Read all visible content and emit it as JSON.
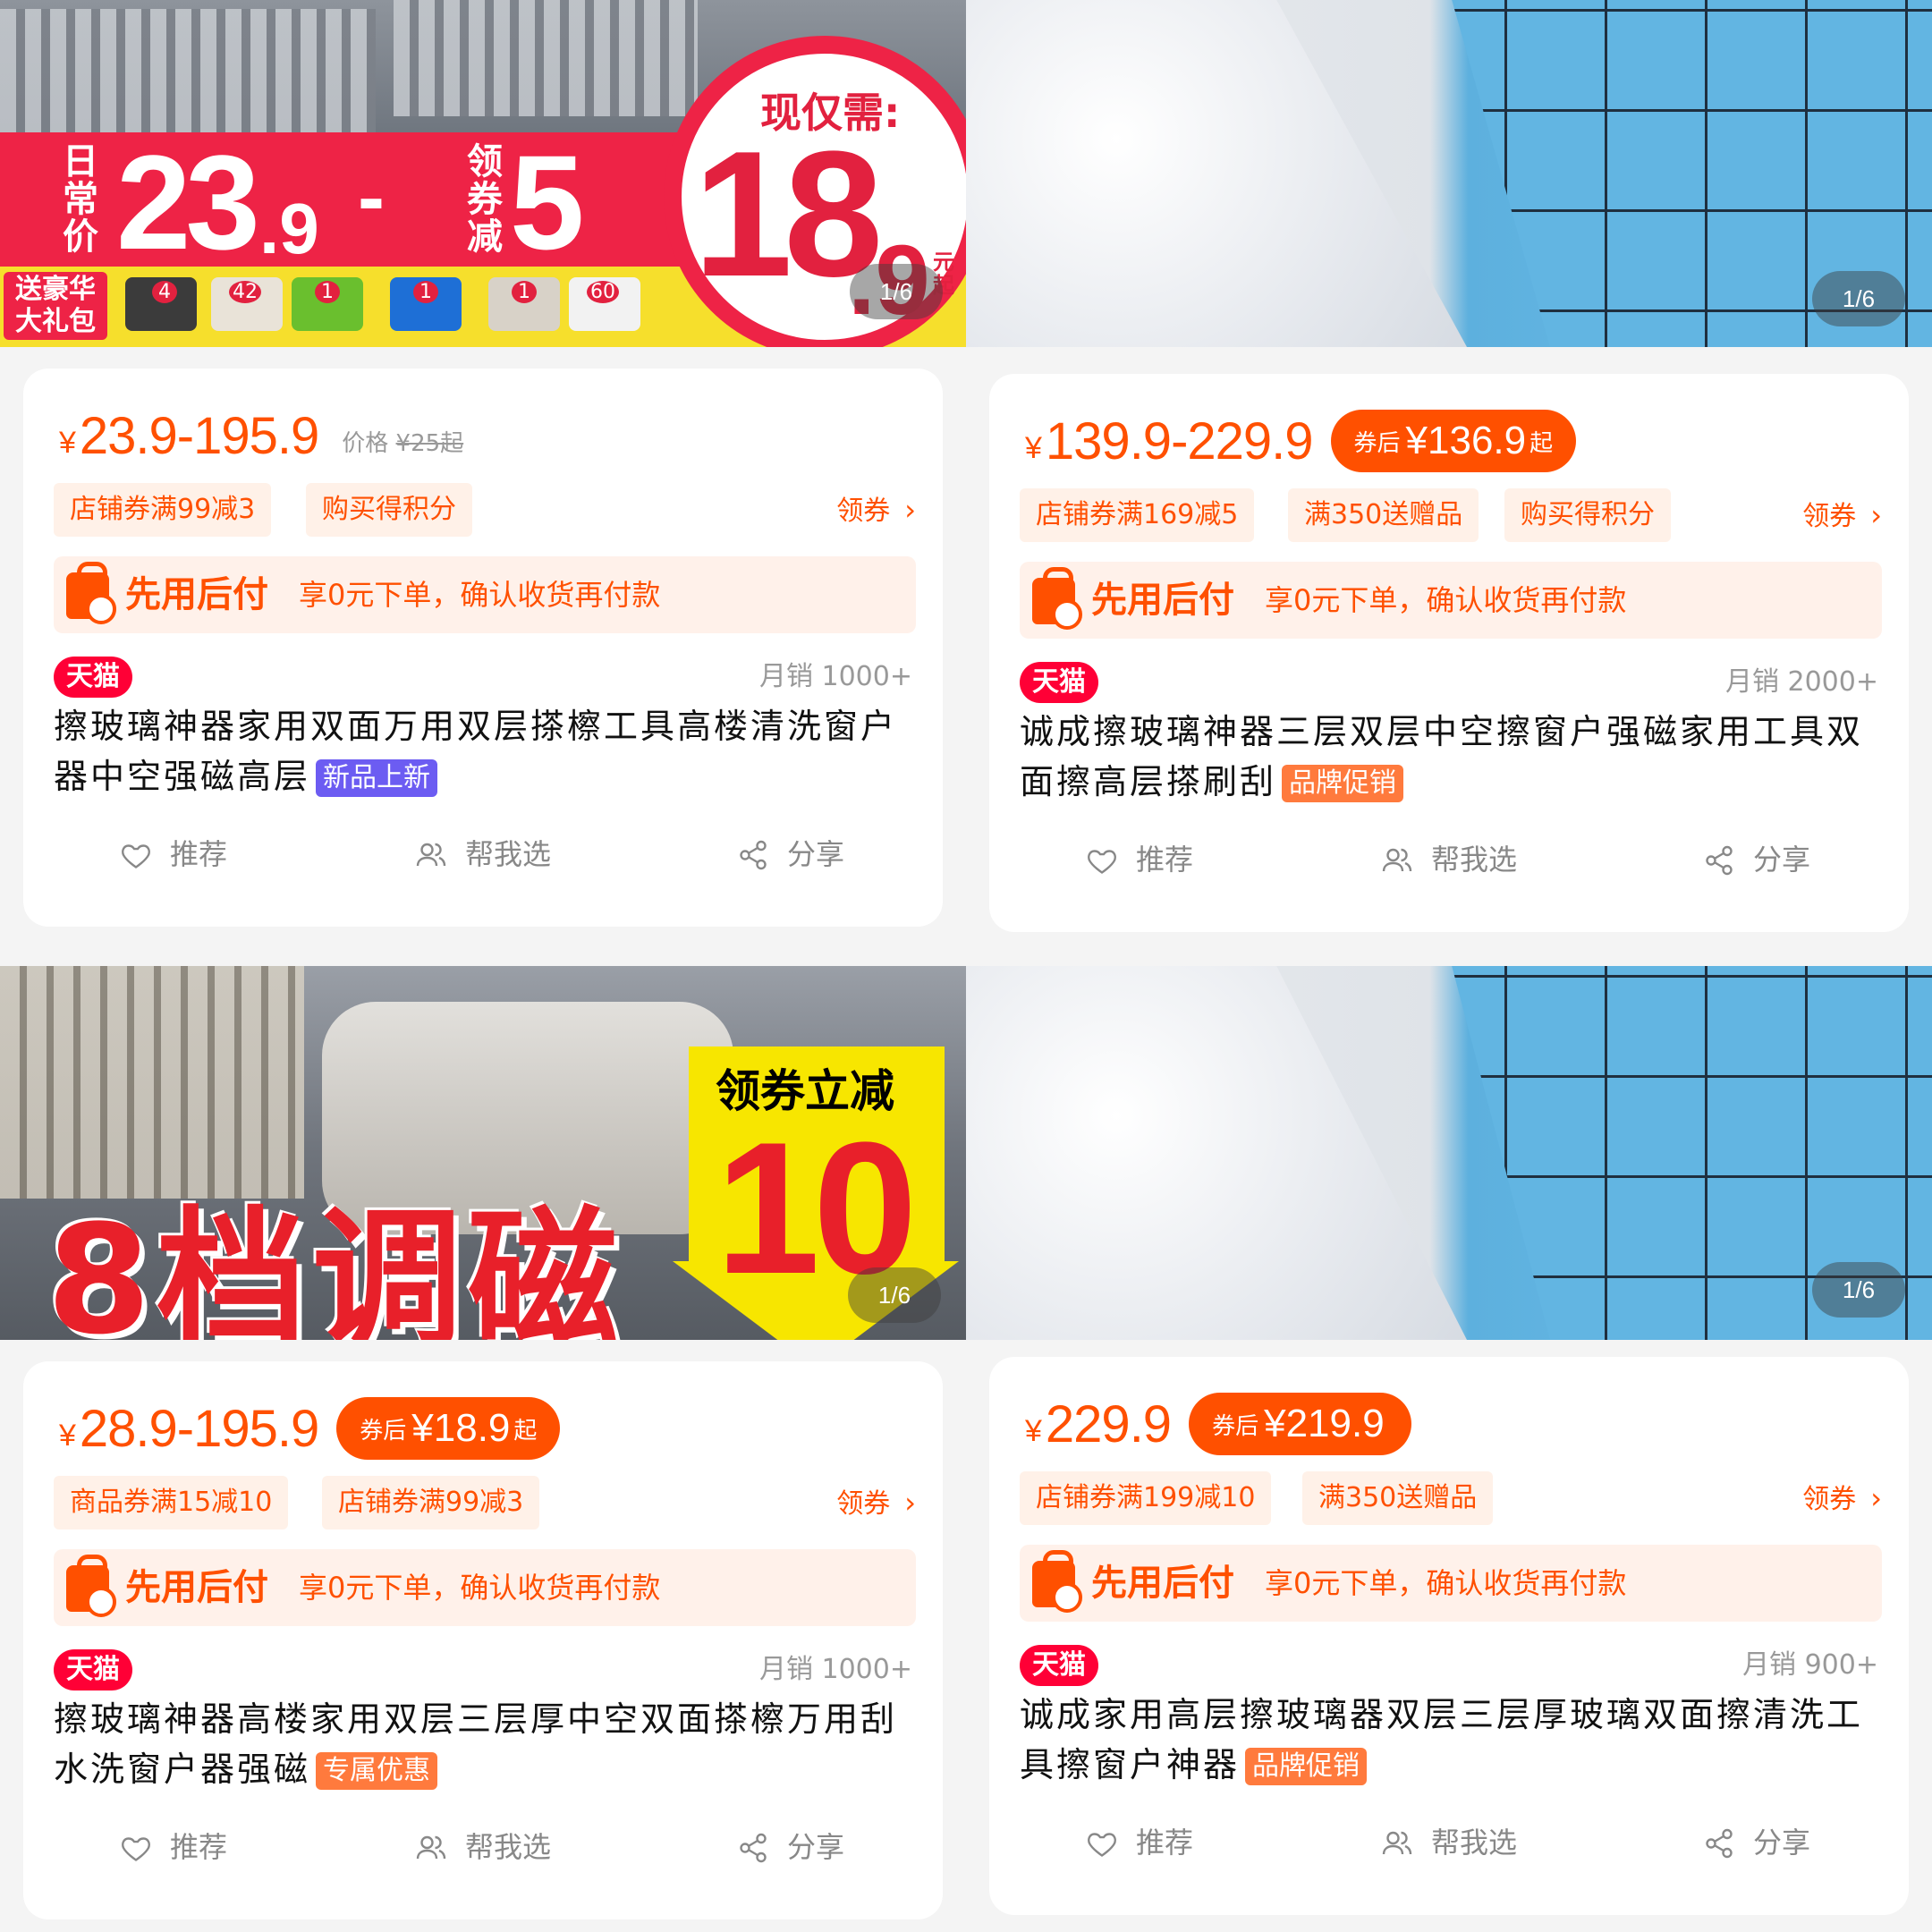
{
  "products": [
    {
      "banner": {
        "pager": "1/6",
        "daily_price_label": "日常价",
        "daily_price_int": "23",
        "daily_price_dec": ".9",
        "minus": "-",
        "coupon_label": "领券减",
        "coupon_amount": "5",
        "now_label": "现仅需:",
        "now_price_int": "18",
        "now_price_dec": ".9",
        "now_suffix": "元起",
        "gift_label": "送豪华大礼包",
        "gift_counts": [
          "4",
          "42",
          "1",
          "1",
          "1",
          "60"
        ]
      },
      "price": "23.9-195.9",
      "orig_label": "价格",
      "orig_price": "¥25起",
      "coupons": [
        "店铺券满99减3",
        "购买得积分"
      ],
      "get_coupon": "领券",
      "pay_title": "先用后付",
      "pay_desc": "享0元下单，确认收货再付款",
      "tmall": "天猫",
      "sales": "月销 1000+",
      "title": "擦玻璃神器家用双面万用双层搽檫工具高楼清洗窗户器中空强磁高层",
      "badge": "新品上新",
      "actions": [
        "推荐",
        "帮我选",
        "分享"
      ]
    },
    {
      "banner": {
        "pager": "1/6"
      },
      "price": "139.9-229.9",
      "after_label": "券后",
      "after_price": "¥136.9",
      "after_suffix": "起",
      "coupons": [
        "店铺券满169减5",
        "满350送赠品",
        "购买得积分"
      ],
      "get_coupon": "领券",
      "pay_title": "先用后付",
      "pay_desc": "享0元下单，确认收货再付款",
      "tmall": "天猫",
      "sales": "月销 2000+",
      "title": "诚成擦玻璃神器三层双层中空擦窗户强磁家用工具双面擦高层搽刷刮",
      "badge": "品牌促销",
      "actions": [
        "推荐",
        "帮我选",
        "分享"
      ]
    },
    {
      "banner": {
        "pager": "1/6",
        "big_text": "8档调磁",
        "coupon_text": "领券立减",
        "coupon_amount": "10"
      },
      "price": "28.9-195.9",
      "after_label": "券后",
      "after_price": "¥18.9",
      "after_suffix": "起",
      "coupons": [
        "商品券满15减10",
        "店铺券满99减3"
      ],
      "get_coupon": "领券",
      "pay_title": "先用后付",
      "pay_desc": "享0元下单，确认收货再付款",
      "tmall": "天猫",
      "sales": "月销 1000+",
      "title": "擦玻璃神器高楼家用双层三层厚中空双面搽檫万用刮水洗窗户器强磁",
      "badge": "专属优惠",
      "actions": [
        "推荐",
        "帮我选",
        "分享"
      ]
    },
    {
      "banner": {
        "pager": "1/6"
      },
      "price": "229.9",
      "after_label": "券后",
      "after_price": "¥219.9",
      "after_suffix": "",
      "coupons": [
        "店铺券满199减10",
        "满350送赠品"
      ],
      "get_coupon": "领券",
      "pay_title": "先用后付",
      "pay_desc": "享0元下单，确认收货再付款",
      "tmall": "天猫",
      "sales": "月销 900+",
      "title": "诚成家用高层擦玻璃器双层三层厚玻璃双面擦清洗工具擦窗户神器",
      "badge": "品牌促销",
      "actions": [
        "推荐",
        "帮我选",
        "分享"
      ]
    }
  ],
  "colors": {
    "accent": "#ff5000",
    "tmall": "#ff0036",
    "badge_purple": "#6c5cf2",
    "badge_orange": "#ff7a3d"
  },
  "icons": [
    "heart-icon",
    "people-icon",
    "share-icon",
    "shopping-bag-icon",
    "chevron-right-icon"
  ]
}
